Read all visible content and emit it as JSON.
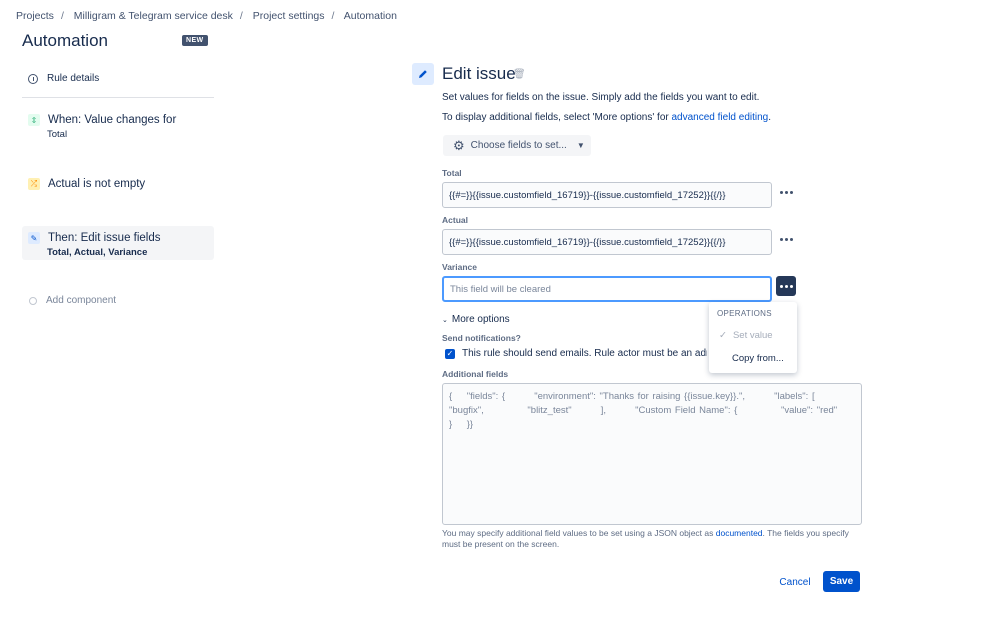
{
  "breadcrumb": [
    "Projects",
    "Milligram & Telegram service desk",
    "Project settings",
    "Automation"
  ],
  "page_title": "Automation",
  "new_badge": "NEW",
  "rule_details": "Rule details",
  "components": {
    "trigger": {
      "title": "When: Value changes for",
      "sub": "Total",
      "icon": "value-change-icon",
      "color": "#36b37e"
    },
    "condition": {
      "title": "Actual is not empty",
      "icon": "shuffle-icon",
      "color": "#ffab00"
    },
    "action": {
      "title": "Then: Edit issue fields",
      "sub_items": [
        "Total",
        "Actual",
        "Variance"
      ],
      "icon": "pencil-icon",
      "color": "#0052cc"
    },
    "add_label": "Add component"
  },
  "editor": {
    "title": "Edit issue",
    "desc1": "Set values for fields on the issue. Simply add the fields you want to edit.",
    "desc2_prefix": "To display additional fields, select 'More options' for ",
    "desc2_link": "advanced field editing",
    "desc2_suffix": ".",
    "choose_fields": "Choose fields to set...",
    "fields": {
      "total_label": "Total",
      "total_value": "{{#=}}{{issue.customfield_16719}}-{{issue.customfield_17252}}{{/}}",
      "actual_label": "Actual",
      "actual_value": "{{#=}}{{issue.customfield_16719}}-{{issue.customfield_17252}}{{/}}",
      "variance_label": "Variance",
      "variance_placeholder": "This field will be cleared"
    },
    "menu": {
      "header": "OPERATIONS",
      "set_value": "Set value",
      "copy_from": "Copy from..."
    },
    "more_options": "More options",
    "send_notifications": "Send notifications?",
    "checkbox_text": "This rule should send emails. Rule actor must be an admin",
    "additional_fields_label": "Additional fields",
    "additional_fields_placeholder": "{    \"fields\": {        \"environment\": \"Thanks for raising {{issue.key}}.\",        \"labels\": [    \"bugfix\",            \"blitz_test\"        ],        \"Custom Field Name\": {            \"value\": \"red\"        }    }}",
    "help_prefix": "You may specify additional field values to be set using a JSON object as ",
    "help_link": "documented",
    "help_suffix": ". The fields you specify must be present on the screen.",
    "cancel": "Cancel",
    "save": "Save"
  }
}
